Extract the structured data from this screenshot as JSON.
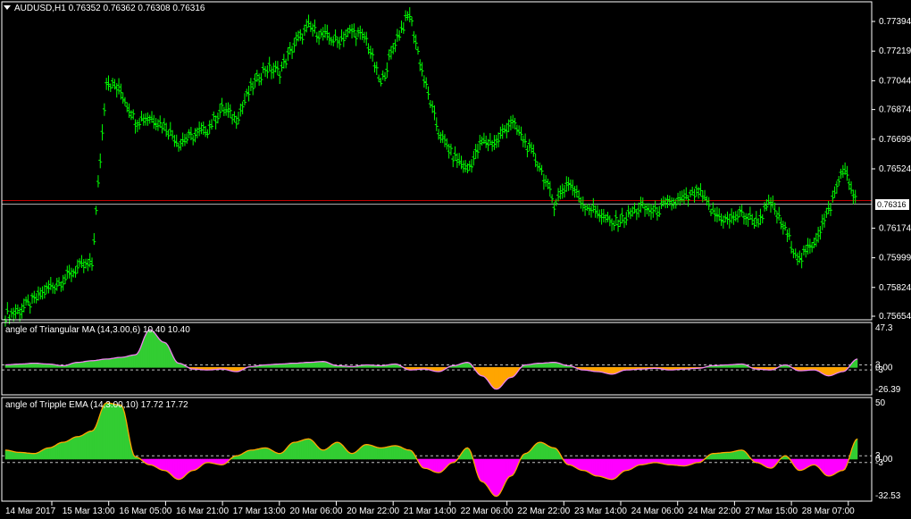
{
  "main_panel": {
    "title": "AUDUSD,H1  0.76352 0.76362 0.76308 0.76316",
    "current_price": "0.76316",
    "price_labels": [
      "0.77394",
      "0.77219",
      "0.77044",
      "0.76874",
      "0.76699",
      "0.76524",
      "0.76174",
      "0.75999",
      "0.75824",
      "0.75654"
    ]
  },
  "indicator1": {
    "title": "angle of Triangular MA (14,3.00,6) 10.40 10.40",
    "scale_labels": [
      "47.3",
      "3",
      "0.00",
      "-3",
      "-26.39"
    ],
    "colors": {
      "up": "#32cd32",
      "down": "#ffa500",
      "line": "#ee82ee"
    }
  },
  "indicator2": {
    "title": "angle of Tripple EMA (14,3.00,10) 17.72 17.72",
    "scale_labels": [
      "50",
      "3",
      "0.00",
      "-3",
      "-32.53"
    ],
    "colors": {
      "up": "#32cd32",
      "down": "#ff00ff",
      "line": "#ffa500"
    }
  },
  "time_axis": [
    "14 Mar 2017",
    "15 Mar 13:00",
    "16 Mar 05:00",
    "16 Mar 21:00",
    "17 Mar 13:00",
    "20 Mar 06:00",
    "20 Mar 22:00",
    "21 Mar 14:00",
    "22 Mar 06:00",
    "22 Mar 22:00",
    "23 Mar 14:00",
    "24 Mar 06:00",
    "24 Mar 22:00",
    "27 Mar 15:00",
    "28 Mar 07:00"
  ],
  "chart_data": {
    "type": "line",
    "title": "AUDUSD,H1",
    "series": [
      {
        "name": "AUDUSD,H1",
        "values": [
          0.7566,
          0.7569,
          0.7575,
          0.7582,
          0.7587,
          0.7594,
          0.7596,
          0.7705,
          0.7698,
          0.7681,
          0.7683,
          0.7678,
          0.7668,
          0.7672,
          0.7676,
          0.7688,
          0.7682,
          0.77,
          0.7712,
          0.771,
          0.7726,
          0.7736,
          0.7731,
          0.7728,
          0.7734,
          0.7729,
          0.7702,
          0.7728,
          0.7744,
          0.7705,
          0.7674,
          0.766,
          0.7652,
          0.7668,
          0.7668,
          0.7681,
          0.7668,
          0.7654,
          0.7632,
          0.7645,
          0.7632,
          0.7627,
          0.762,
          0.7624,
          0.763,
          0.7627,
          0.7632,
          0.7634,
          0.7639,
          0.7626,
          0.7622,
          0.7626,
          0.7621,
          0.7632,
          0.7616,
          0.7598,
          0.761,
          0.7627,
          0.7653,
          0.7632
        ]
      },
      {
        "name": "angle of Triangular MA (14,3.00,6)",
        "values": [
          3,
          4,
          5,
          4,
          2,
          6,
          8,
          10,
          12,
          15,
          45,
          30,
          5,
          -2,
          -3,
          -2,
          -5,
          1,
          3,
          4,
          5,
          6,
          7,
          2,
          1,
          3,
          2,
          4,
          -3,
          -2,
          -5,
          2,
          6,
          -10,
          -26,
          -12,
          3,
          5,
          6,
          2,
          -3,
          -5,
          -8,
          -3,
          -2,
          -1,
          -3,
          -2,
          -1,
          2,
          3,
          4,
          -2,
          -3,
          3,
          -4,
          -3,
          -10,
          -5,
          10
        ]
      },
      {
        "name": "angle of Tripple EMA (14,3.00,10)",
        "values": [
          8,
          6,
          5,
          10,
          15,
          20,
          25,
          50,
          48,
          2,
          -5,
          -10,
          -18,
          -10,
          -3,
          -5,
          3,
          8,
          10,
          5,
          15,
          18,
          8,
          15,
          5,
          13,
          10,
          12,
          8,
          -8,
          -12,
          -3,
          10,
          -20,
          -33,
          -15,
          5,
          15,
          10,
          -5,
          -10,
          -15,
          -18,
          -10,
          -5,
          -3,
          -5,
          -6,
          -3,
          5,
          6,
          8,
          -3,
          -8,
          3,
          -10,
          -5,
          -15,
          -10,
          18
        ]
      }
    ],
    "ylim": [
      0.75654,
      0.77394
    ]
  }
}
